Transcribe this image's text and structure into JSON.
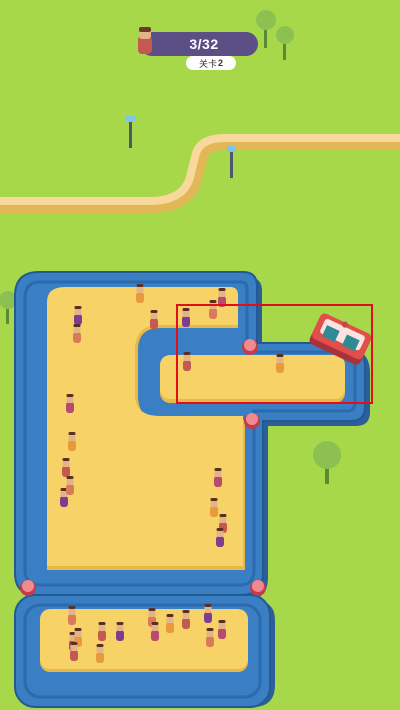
{
  "hud": {
    "passenger_count": "3/32",
    "level_label": "关卡",
    "level_number": "2",
    "passenger_icon": "person-icon"
  },
  "colors": {
    "grass": "#a6d84a",
    "track": "#3a7ec3",
    "platform": "#f7d267",
    "train": "#e24f4b",
    "highlight": "#e00f1b",
    "hud_bg": "#5b4f86"
  }
}
